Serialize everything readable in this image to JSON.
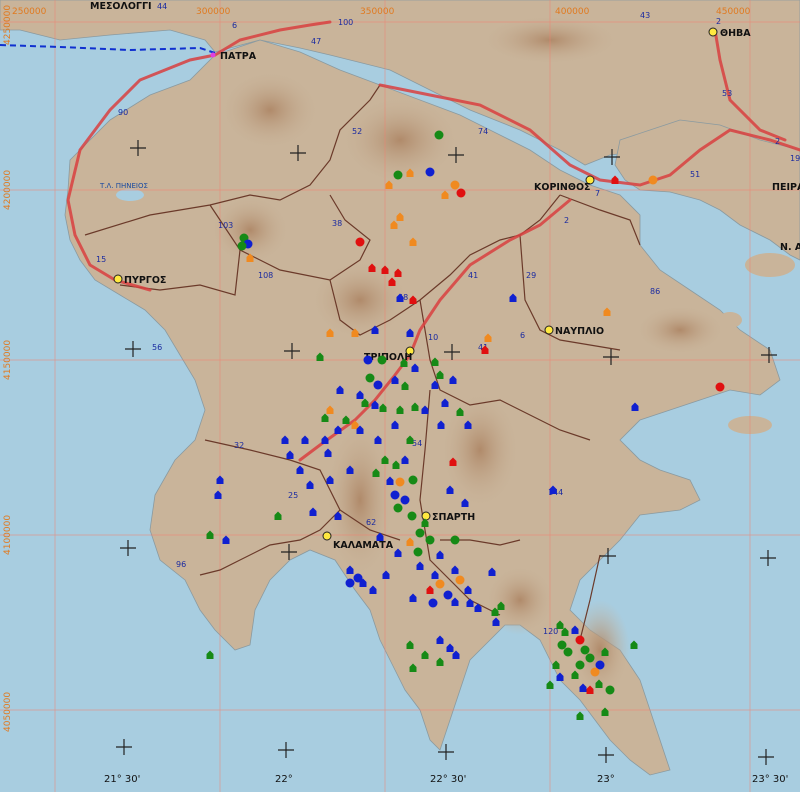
{
  "map": {
    "grid_labels_top": [
      "250000",
      "300000",
      "350000",
      "400000",
      "450000"
    ],
    "grid_labels_left": [
      "4250000",
      "4200000",
      "4150000",
      "4100000",
      "4050000"
    ],
    "longitude_labels": [
      "21° 30'",
      "22°",
      "22° 30'",
      "23°",
      "23° 30'"
    ],
    "cities": [
      {
        "name": "ΜΕΣΟΛΟΓΓΙ"
      },
      {
        "name": "ΠΑΤΡΑ"
      },
      {
        "name": "ΘΗΒΑ"
      },
      {
        "name": "ΚΟΡΙΝΘΟΣ"
      },
      {
        "name": "ΠΕΙΡΑ"
      },
      {
        "name": "Ν. ΑΙ"
      },
      {
        "name": "ΠΥΡΓΟΣ"
      },
      {
        "name": "ΝΑΥΠΛΙΟ"
      },
      {
        "name": "ΤΡΙΠΟΛΗ"
      },
      {
        "name": "ΣΠΑΡΤΗ"
      },
      {
        "name": "ΚΑΛΑΜΑΤΑ"
      }
    ],
    "lake_label": "Τ.Λ. ΠΗΝΕΙΟΣ",
    "road_numbers": [
      "44",
      "6",
      "100",
      "43",
      "2",
      "47",
      "90",
      "52",
      "74",
      "7",
      "2",
      "51",
      "53",
      "2",
      "19",
      "103",
      "38",
      "108",
      "15",
      "41",
      "29",
      "86",
      "48",
      "10",
      "6",
      "41",
      "56",
      "32",
      "54",
      "25",
      "62",
      "144",
      "96",
      "120"
    ],
    "colors": {
      "sea": "#a8cde0",
      "land": "#c9b49a",
      "highway": "#d94040",
      "boundary": "#6b3a2a",
      "grid": "#f08070",
      "blue_marker": "#1020d0",
      "green_marker": "#168a16",
      "orange_marker": "#f08a20",
      "red_marker": "#e01010"
    }
  }
}
